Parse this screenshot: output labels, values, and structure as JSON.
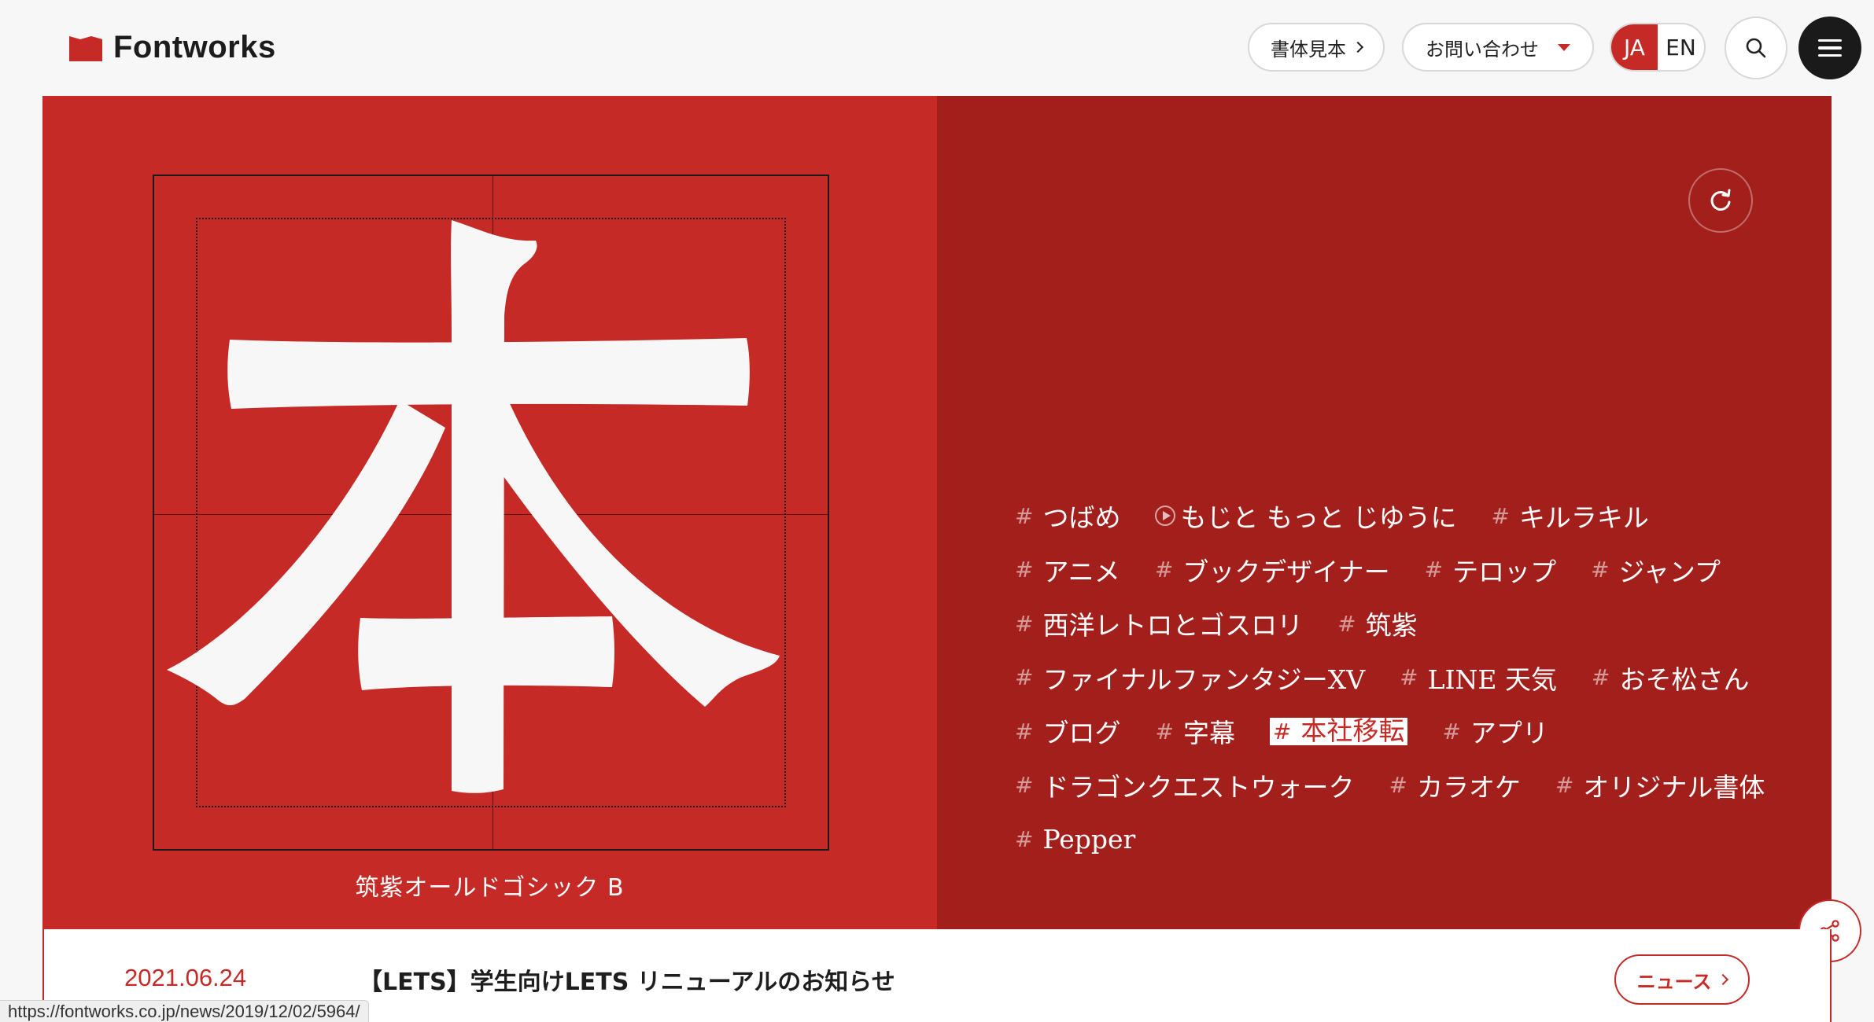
{
  "header": {
    "logo_text": "Fontworks",
    "shotai_label": "書体見本",
    "contact_label": "お問い合わせ",
    "lang_ja": "JA",
    "lang_en": "EN",
    "icons": [
      "search-icon",
      "menu-icon"
    ]
  },
  "hero": {
    "glyph": "本",
    "font_name": "筑紫オールドゴシック B",
    "tag_rows": [
      [
        {
          "label": "つばめ",
          "hash": "#"
        },
        {
          "label": "もじと もっと じゆうに",
          "play": true
        },
        {
          "label": "キルラキル",
          "hash": "#"
        }
      ],
      [
        {
          "label": "アニメ",
          "hash": "#"
        },
        {
          "label": "ブックデザイナー",
          "hash": "#"
        },
        {
          "label": "テロップ",
          "hash": "#"
        },
        {
          "label": "ジャンプ",
          "hash": "#"
        }
      ],
      [
        {
          "label": "西洋レトロとゴスロリ",
          "hash": "#"
        },
        {
          "label": "筑紫",
          "hash": "#"
        }
      ],
      [
        {
          "label": "ファイナルファンタジーXV",
          "hash": "#"
        },
        {
          "label": "LINE 天気",
          "hash": "#"
        },
        {
          "label": "おそ松さん",
          "hash": "#"
        }
      ],
      [
        {
          "label": "ブログ",
          "hash": "#"
        },
        {
          "label": "字幕",
          "hash": "#"
        },
        {
          "label": "本社移転",
          "hash": "#",
          "active": true
        },
        {
          "label": "アプリ",
          "hash": "#"
        }
      ],
      [
        {
          "label": "ドラゴンクエストウォーク",
          "hash": "#"
        },
        {
          "label": "カラオケ",
          "hash": "#"
        },
        {
          "label": "オリジナル書体",
          "hash": "#"
        }
      ],
      [
        {
          "label": "Pepper",
          "hash": "#"
        }
      ]
    ]
  },
  "news": {
    "date": "2021.06.24",
    "title": "【LETS】学生向けLETS リニューアルのお知らせ",
    "button_label": "ニュース"
  },
  "status_bar": {
    "url": "https://fontworks.co.jp/news/2019/12/02/5964/"
  },
  "colors": {
    "brand_red": "#c62a26",
    "dark_red": "#a21f1c",
    "glyph": "#f7f7f7"
  }
}
